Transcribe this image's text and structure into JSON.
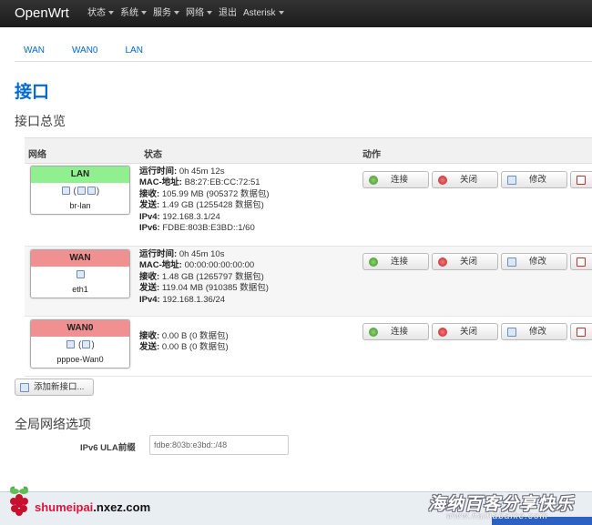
{
  "nav": {
    "brand": "OpenWrt",
    "items": [
      {
        "label": "状态",
        "dropdown": true
      },
      {
        "label": "系统",
        "dropdown": true
      },
      {
        "label": "服务",
        "dropdown": true
      },
      {
        "label": "网络",
        "dropdown": true
      },
      {
        "label": "退出",
        "dropdown": false
      },
      {
        "label": "Asterisk",
        "dropdown": true
      }
    ]
  },
  "subtabs": [
    "WAN",
    "WAN0",
    "LAN"
  ],
  "page_title": "接口",
  "section_title": "接口总览",
  "table": {
    "headers": {
      "network": "网络",
      "status": "状态",
      "actions": "动作"
    },
    "rows": [
      {
        "name": "LAN",
        "device": "br-lan",
        "icons": "(  )",
        "head_color": "#90f090",
        "status": [
          {
            "k": "运行时间:",
            "v": "0h 45m 12s"
          },
          {
            "k": "MAC-地址:",
            "v": "B8:27:EB:CC:72:51"
          },
          {
            "k": "接收:",
            "v": "105.99 MB (905372 数据包)"
          },
          {
            "k": "发送:",
            "v": "1.49 GB (1255428 数据包)"
          },
          {
            "k": "IPv4:",
            "v": "192.168.3.1/24"
          },
          {
            "k": "IPv6:",
            "v": "FDBE:803B:E3BD::1/60"
          }
        ]
      },
      {
        "name": "WAN",
        "device": "eth1",
        "icons": "",
        "head_color": "#f09090",
        "status": [
          {
            "k": "运行时间:",
            "v": "0h 45m 10s"
          },
          {
            "k": "MAC-地址:",
            "v": "00:00:00:00:00:00"
          },
          {
            "k": "接收:",
            "v": "1.48 GB (1265797 数据包)"
          },
          {
            "k": "发送:",
            "v": "119.04 MB (910385 数据包)"
          },
          {
            "k": "IPv4:",
            "v": "192.168.1.36/24"
          }
        ]
      },
      {
        "name": "WAN0",
        "device": "pppoe-Wan0",
        "icons": "( )",
        "head_color": "#f09090",
        "status": [
          {
            "k": "接收:",
            "v": "0.00 B (0 数据包)"
          },
          {
            "k": "发送:",
            "v": "0.00 B (0 数据包)"
          }
        ]
      }
    ],
    "buttons": {
      "connect": "连接",
      "close": "关闭",
      "edit": "修改"
    }
  },
  "add_button": "添加新接口...",
  "global_title": "全局网络选项",
  "ula": {
    "label": "IPv6 ULA前缀",
    "value": "fdbe:803b:e3bd::/48"
  },
  "footer": {
    "site_prefix": "shumeipai",
    "site_suffix": ".nxez.com",
    "watermark": "海纳百客分享快乐",
    "watermark_sub": "www.hainabaike.com"
  }
}
